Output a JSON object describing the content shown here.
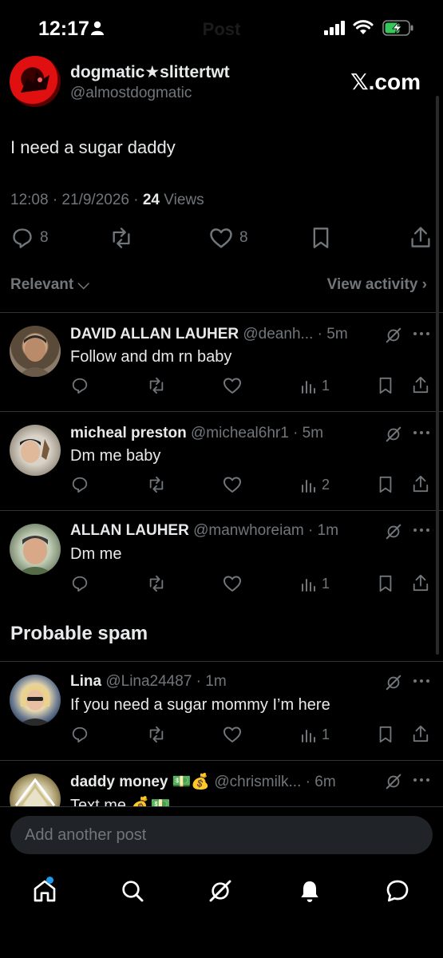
{
  "status": {
    "time": "12:17",
    "faded_title": "Post"
  },
  "post": {
    "display_name": "dogmatic★slittertwt",
    "handle": "@almostdogmatic",
    "brand": "𝕏.com",
    "text": "I need a sugar daddy",
    "timestamp": "12:08 · 21/9/2026 · ",
    "views_count": "24",
    "views_label": " Views",
    "replies": "8",
    "likes": "8"
  },
  "sort": {
    "relevant_label": "Relevant ⌵",
    "view_activity_label": "View activity ›"
  },
  "spam_section_title": "Probable spam",
  "replies": [
    {
      "name": "DAVID ALLAN LAUHER",
      "handle": "@deanh...",
      "time": "· 5m",
      "text": "Follow and dm rn baby",
      "views": "1"
    },
    {
      "name": "micheal preston",
      "handle": "@micheal6hr1",
      "time": "· 5m",
      "text": "Dm me baby",
      "views": "2"
    },
    {
      "name": "ALLAN LAUHER",
      "handle": "@manwhoreiam",
      "time": "· 1m",
      "text": "Dm me",
      "views": "1"
    }
  ],
  "spam_replies": [
    {
      "name": "Lina",
      "handle": "@Lina24487",
      "time": "· 1m",
      "text": "If you need a sugar mommy I’m here",
      "views": "1"
    },
    {
      "name": "daddy money 💵💰",
      "handle": "@chrismilk...",
      "time": "· 6m",
      "text": "Text me 💰💵",
      "views": ""
    }
  ],
  "compose": {
    "placeholder": "Add another post"
  },
  "icons": {
    "reply": "reply-icon",
    "repost": "repost-icon",
    "like": "heart-icon",
    "views": "analytics-icon",
    "bookmark": "bookmark-icon",
    "share": "share-icon",
    "grok": "grok-icon",
    "more": "more-icon"
  },
  "colors": {
    "background": "#000000",
    "text": "#e7e9ea",
    "muted": "#71767b",
    "accent": "#1d9bf0",
    "divider": "#2f3336",
    "battery": "#34c759"
  }
}
